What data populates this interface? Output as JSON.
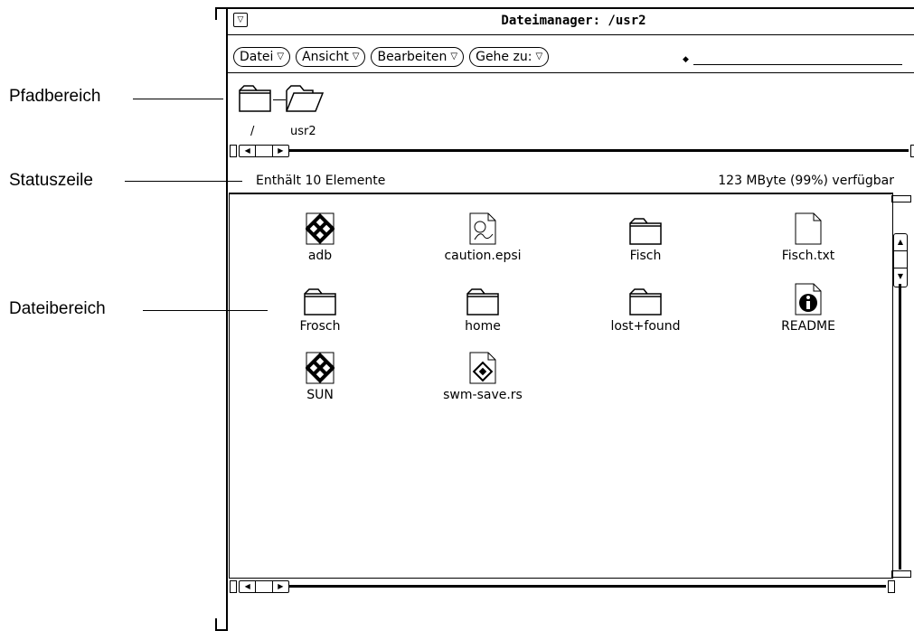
{
  "callouts": {
    "path_area": "Pfadbereich",
    "status_line": "Statuszeile",
    "file_area": "Dateibereich"
  },
  "window": {
    "title": "Dateimanager: /usr2"
  },
  "menu": {
    "file": "Datei",
    "view": "Ansicht",
    "edit": "Bearbeiten",
    "goto": "Gehe zu:"
  },
  "path": [
    {
      "label": "/",
      "icon": "folder-icon"
    },
    {
      "label": "usr2",
      "icon": "folder-open-icon"
    }
  ],
  "status": {
    "count": "Enthält 10 Elemente",
    "free": "123 MByte (99%) verfügbar"
  },
  "files": [
    {
      "name": "adb",
      "icon": "executable-icon"
    },
    {
      "name": "caution.epsi",
      "icon": "image-file-icon"
    },
    {
      "name": "Fisch",
      "icon": "folder-icon"
    },
    {
      "name": "Fisch.txt",
      "icon": "document-icon"
    },
    {
      "name": "Frosch",
      "icon": "folder-icon"
    },
    {
      "name": "home",
      "icon": "folder-icon"
    },
    {
      "name": "lost+found",
      "icon": "folder-icon"
    },
    {
      "name": "README",
      "icon": "info-document-icon"
    },
    {
      "name": "SUN",
      "icon": "executable-icon"
    },
    {
      "name": "swm-save.rs",
      "icon": "raster-file-icon"
    }
  ]
}
